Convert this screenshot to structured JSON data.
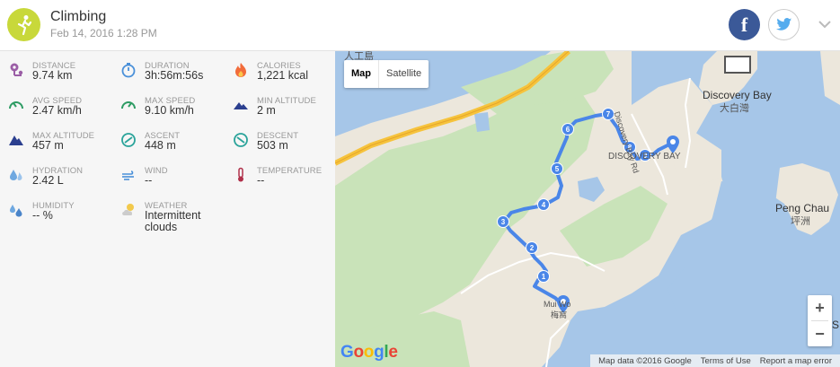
{
  "header": {
    "title": "Climbing",
    "datetime": "Feb 14, 2016 1:28 PM",
    "facebook_glyph": "f",
    "brand_color": "#c8d83a"
  },
  "stats": [
    {
      "label": "DISTANCE",
      "value": "9.74 km",
      "icon": "pin-distance-icon",
      "color": "#9b5ea6"
    },
    {
      "label": "DURATION",
      "value": "3h:56m:56s",
      "icon": "stopwatch-icon",
      "color": "#4a90d9"
    },
    {
      "label": "CALORIES",
      "value": "1,221 kcal",
      "icon": "flame-icon",
      "color": "#f26c3a"
    },
    {
      "label": "AVG SPEED",
      "value": "2.47 km/h",
      "icon": "speedometer-icon",
      "color": "#2e9c64"
    },
    {
      "label": "MAX SPEED",
      "value": "9.10 km/h",
      "icon": "speedometer-max-icon",
      "color": "#2e9c64"
    },
    {
      "label": "MIN ALTITUDE",
      "value": "2 m",
      "icon": "mountain-min-icon",
      "color": "#2b3f8f"
    },
    {
      "label": "MAX ALTITUDE",
      "value": "457 m",
      "icon": "mountain-max-icon",
      "color": "#2b3f8f"
    },
    {
      "label": "ASCENT",
      "value": "448 m",
      "icon": "ascent-icon",
      "color": "#2aa39a"
    },
    {
      "label": "DESCENT",
      "value": "503 m",
      "icon": "descent-icon",
      "color": "#2aa39a"
    },
    {
      "label": "HYDRATION",
      "value": "2.42 L",
      "icon": "water-drops-icon",
      "color": "#6fa8e0"
    },
    {
      "label": "WIND",
      "value": "--",
      "icon": "wind-icon",
      "color": "#4a90d9"
    },
    {
      "label": "TEMPERATURE",
      "value": "--",
      "icon": "thermometer-icon",
      "color": "#b0304a"
    },
    {
      "label": "HUMIDITY",
      "value": "-- %",
      "icon": "humidity-drops-icon",
      "color": "#6fa8e0"
    },
    {
      "label": "WEATHER",
      "value": "Intermittent clouds",
      "icon": "weather-cloud-icon",
      "color": "#f2c94c"
    }
  ],
  "map": {
    "type_buttons": [
      "Map",
      "Satellite"
    ],
    "active_type": "Map",
    "zoom_in": "+",
    "zoom_out": "−",
    "logo": "Google",
    "attribution": [
      "Map data ©2016 Google",
      "Terms of Use",
      "Report a map error"
    ],
    "labels": {
      "discovery_bay": "Discovery Bay",
      "discovery_bay_zh": "大白灣",
      "discovery_bay_rd": "Discovery Bay Rd",
      "peng_chau": "Peng Chau",
      "peng_chau_zh": "坪洲",
      "island_top": "人工島",
      "disco_town": "DISCOVERY BAY",
      "mui_wo": "Mui Wo",
      "mui_wo_zh": "梅窩",
      "edge_s": "S"
    },
    "route_markers": [
      "1",
      "2",
      "3",
      "4",
      "5",
      "6",
      "7",
      "8",
      "9"
    ],
    "route_color": "#4a86e8"
  }
}
